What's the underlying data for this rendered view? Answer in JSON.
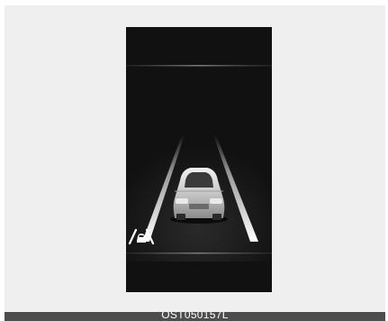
{
  "figure": {
    "caption": "OST050157L"
  },
  "display": {
    "background": "#111111",
    "icons": {
      "lane_keeping": "lane-keeping-assist-icon",
      "vehicle": "vehicle-rear-view-icon"
    }
  },
  "colors": {
    "panel": "#efefef",
    "caption_bar": "#4d4d4d",
    "caption_text": "#ffffff",
    "lane_line": "#ffffff"
  }
}
